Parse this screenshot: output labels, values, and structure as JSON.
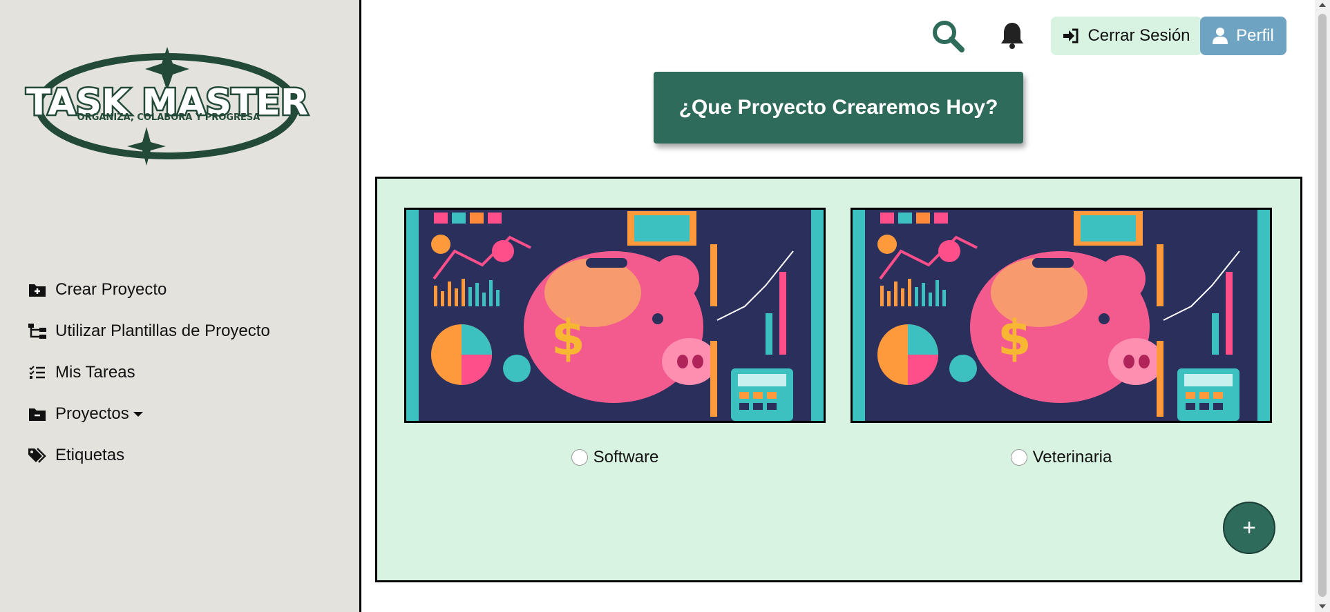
{
  "sidebar": {
    "logo": {
      "title": "TASK MASTER",
      "tagline": "ORGANIZA, COLABORA Y PROGRESA"
    },
    "items": [
      {
        "label": "Crear Proyecto",
        "icon": "folder-plus-icon"
      },
      {
        "label": "Utilizar Plantillas de Proyecto",
        "icon": "sitemap-icon"
      },
      {
        "label": "Mis Tareas",
        "icon": "list-check-icon"
      },
      {
        "label": "Proyectos",
        "icon": "folder-minus-icon",
        "dropdown": true
      },
      {
        "label": "Etiquetas",
        "icon": "tags-icon"
      }
    ]
  },
  "header": {
    "search_icon": "search-icon",
    "bell_icon": "bell-icon",
    "logout_label": "Cerrar Sesión",
    "profile_label": "Perfil"
  },
  "main": {
    "hero_label": "¿Que Proyecto Crearemos Hoy?",
    "templates": [
      {
        "name": "Software"
      },
      {
        "name": "Veterinaria"
      }
    ],
    "fab_label": "+"
  },
  "colors": {
    "accent": "#2e6b5a",
    "panel_bg": "#d8f3e2",
    "sidebar_bg": "#e3e2dd",
    "profile": "#6fa3c2"
  }
}
